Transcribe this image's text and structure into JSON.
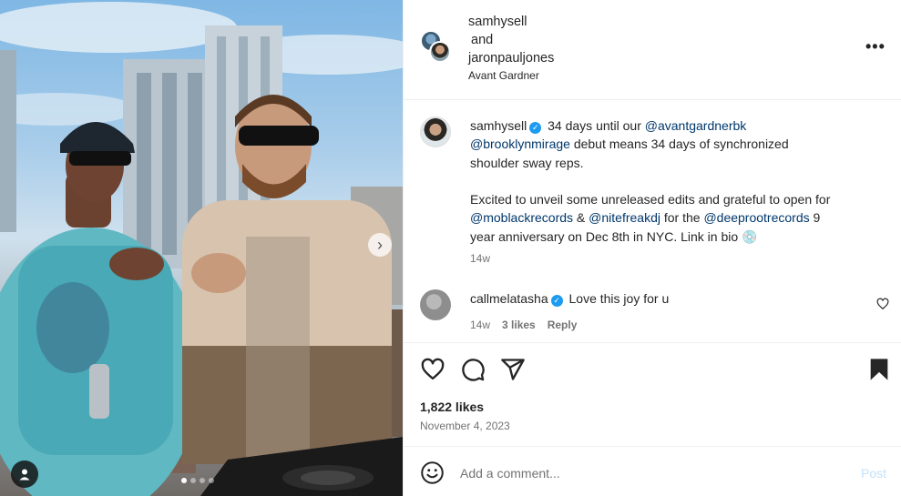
{
  "post": {
    "authors": [
      "samhysell",
      "and",
      "jaronpauljones"
    ],
    "location": "Avant Gardner",
    "caption": {
      "username": "samhysell",
      "p1_text1": "34 days until our",
      "mention1": "@avantgardnerbk",
      "mention2": "@brooklynmirage",
      "p1_text2": "debut means 34 days of synchronized",
      "p1_line3": "shoulder sway reps.",
      "p2_line1": "Excited to unveil some unreleased edits and grateful to open for",
      "mention3": "@moblackrecords",
      "amp": "&",
      "mention4": "@nitefreakdj",
      "p2_for_the": "for the",
      "mention5": "@deeprootrecords",
      "p2_nine": "9",
      "p2_line3": "year anniversary on Dec 8th in NYC. Link in bio",
      "emoji": "💿",
      "time": "14w"
    },
    "comment": {
      "username": "callmelatasha",
      "text": "Love this joy for u",
      "time": "14w",
      "likes": "3 likes",
      "reply": "Reply"
    },
    "likes": "1,822 likes",
    "date": "November 4, 2023",
    "add_comment": {
      "placeholder": "Add a comment...",
      "post_label": "Post"
    },
    "carousel": {
      "slide_count": 4,
      "active_index": 0
    },
    "icons": [
      "heart-icon",
      "comment-icon",
      "share-icon",
      "bookmark-icon",
      "emoji-icon",
      "more-icon",
      "user-tag-icon",
      "chevron-right-icon",
      "verified-badge-icon"
    ],
    "colors": {
      "mention": "#00376b",
      "verified": "#1d9bf0",
      "post_button_disabled": "#c4e1fb",
      "secondary_text": "#737373"
    }
  }
}
